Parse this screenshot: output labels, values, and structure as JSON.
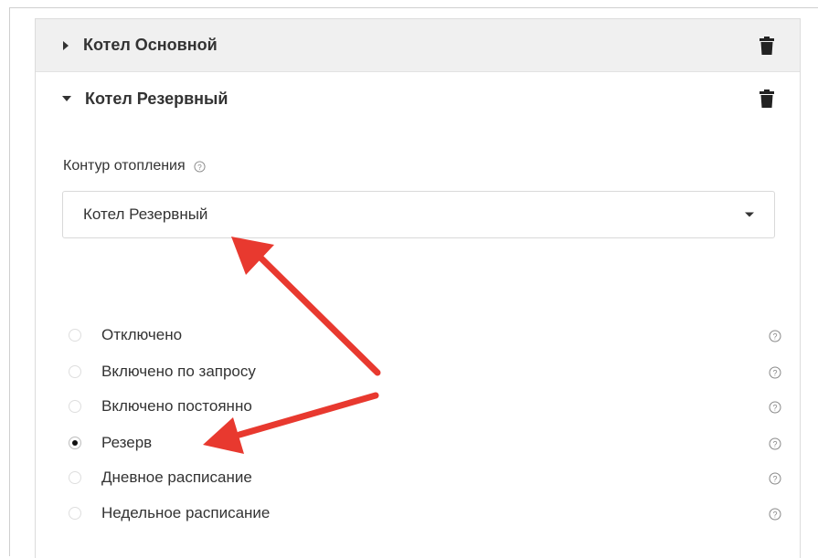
{
  "sections": {
    "main": {
      "title": "Котел Основной",
      "expanded": false
    },
    "reserve": {
      "title": "Котел Резервный",
      "expanded": true
    }
  },
  "field": {
    "label": "Контур отопления",
    "selected": "Котел Резервный"
  },
  "modes": [
    {
      "label": "Отключено",
      "checked": false
    },
    {
      "label": "Включено по запросу",
      "checked": false
    },
    {
      "label": "Включено постоянно",
      "checked": false
    },
    {
      "label": "Резерв",
      "checked": true
    },
    {
      "label": "Дневное расписание",
      "checked": false
    },
    {
      "label": "Недельное расписание",
      "checked": false
    }
  ],
  "colors": {
    "annotation_arrow": "#e8392f",
    "header_bg": "#f0f0f0"
  },
  "icons": {
    "trash": "trash-icon",
    "help": "question-circle-icon"
  }
}
